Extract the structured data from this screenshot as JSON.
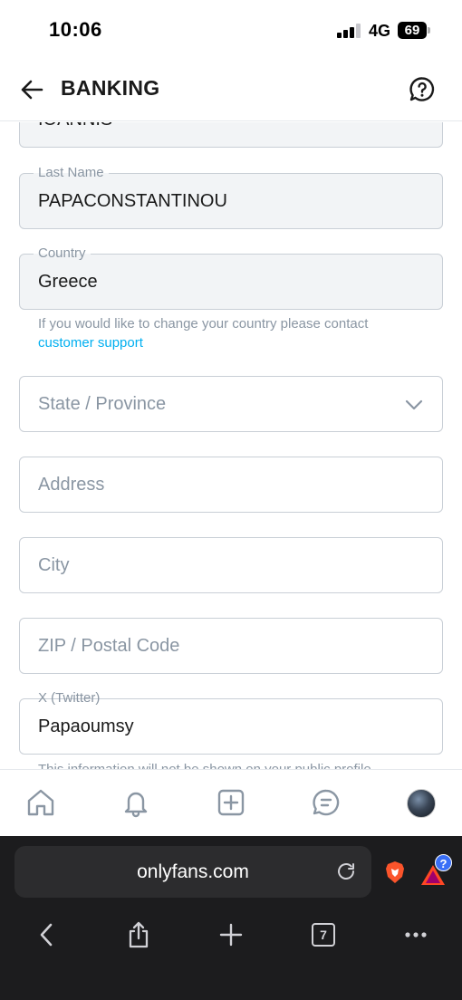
{
  "status_bar": {
    "time": "10:06",
    "network": "4G",
    "battery": "69"
  },
  "header": {
    "title": "BANKING"
  },
  "form": {
    "first_name_value": "IOANNIS",
    "last_name": {
      "label": "Last Name",
      "value": "PAPACONSTANTINOU"
    },
    "country": {
      "label": "Country",
      "value": "Greece"
    },
    "country_hint": "If you would like to change your country please contact",
    "country_hint_link": "customer support",
    "state": {
      "placeholder": "State / Province"
    },
    "address": {
      "placeholder": "Address"
    },
    "city": {
      "placeholder": "City"
    },
    "zip": {
      "placeholder": "ZIP / Postal Code"
    },
    "twitter": {
      "label": "X (Twitter)",
      "value": "Papaoumsy"
    },
    "twitter_hint": "This information will not be shown on your public profile"
  },
  "browser": {
    "url": "onlyfans.com",
    "tab_count": "7",
    "rewards_badge": "?"
  },
  "colors": {
    "accent": "#00aff0",
    "muted_text": "#8a96a3",
    "field_border": "#c9cfd6",
    "field_fill": "#f2f4f6"
  }
}
